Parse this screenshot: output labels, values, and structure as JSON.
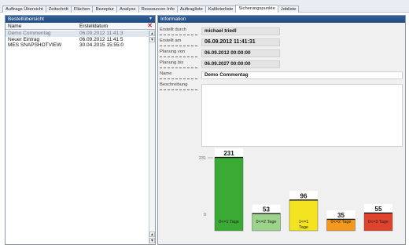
{
  "tabs": [
    "Auftrags Übersicht",
    "Zeitschritt",
    "Flächen",
    "Rezeptur",
    "Analyse",
    "Ressourcen Info",
    "Auftragliste",
    "Kalibrierliste",
    "Sicherungspunkte",
    "Jobliste"
  ],
  "active_tab_index": 8,
  "left_panel": {
    "title": "Bestellübersicht",
    "pin_icon": "pin-icon",
    "columns": {
      "name": "Name",
      "date": "Erstelldatum"
    },
    "rows": [
      {
        "name": "Demo Commentag",
        "date": "06.09.2012 11:41:3",
        "selected": true
      },
      {
        "name": "Neuer Eintrag",
        "date": "06.09.2012 11:41:5",
        "selected": false
      },
      {
        "name": "MES SNAPSHOTVIEW",
        "date": "30.04.2015 15:55:0",
        "selected": false
      }
    ]
  },
  "right_panel": {
    "title": "Information",
    "fields": [
      {
        "label": "Erstellt durch",
        "value": "michael triedl"
      },
      {
        "label": "Erstellt am",
        "value": "06.09.2012 11:41:31"
      },
      {
        "label": "Planung von",
        "value": "06.09.2012 00:00:00"
      },
      {
        "label": "Planung bis",
        "value": "06.09.2027 00:00:00"
      },
      {
        "label": "Name",
        "value": "Demo Commentag"
      },
      {
        "label": "Beschreibung",
        "value": ""
      }
    ]
  },
  "chart_data": {
    "type": "bar",
    "categories": [
      "0<=1 Tage",
      "0<=2 Tage",
      "1<=1 Tage",
      "0<=2 Tage",
      "0<=3 Tage"
    ],
    "category_lines": [
      [
        "0<=1 Tage"
      ],
      [
        "0<=2 Tage"
      ],
      [
        "1<=1",
        "Tage"
      ],
      [
        "0<=2 Tage"
      ],
      [
        "0<=3 Tage"
      ]
    ],
    "values": [
      231,
      53,
      96,
      35,
      55
    ],
    "colors": [
      "#3aaa35",
      "#9cd38b",
      "#f3e320",
      "#f39a1e",
      "#e0432c"
    ],
    "ylim": [
      0,
      231
    ],
    "ytick_labels": [
      "0",
      "231"
    ],
    "title": "",
    "xlabel": "",
    "ylabel": ""
  }
}
